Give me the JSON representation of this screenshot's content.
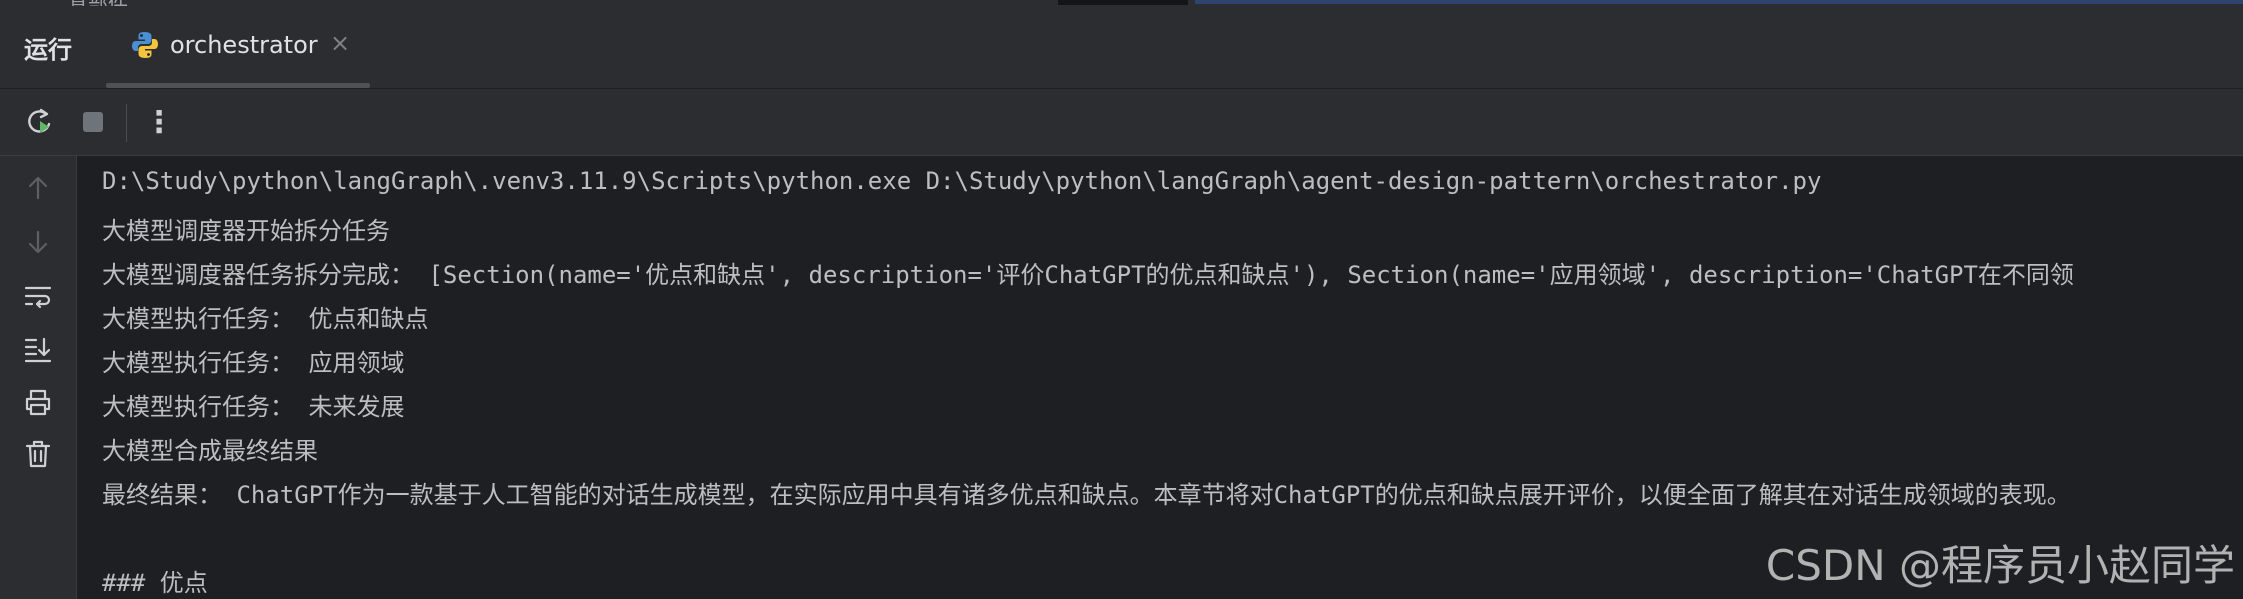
{
  "top_strip": {
    "glyph": "具部件"
  },
  "panel": {
    "title": "运行"
  },
  "tab": {
    "label": "orchestrator",
    "close": "×",
    "icon": "python-icon"
  },
  "toolbar": {
    "rerun_icon": "rerun-icon",
    "stop_icon": "stop-icon",
    "more": "⋮"
  },
  "gutter": {
    "icons": [
      "arrow-up-icon",
      "arrow-down-icon",
      "soft-wrap-icon",
      "scroll-to-end-icon",
      "print-icon",
      "trash-icon"
    ]
  },
  "console": {
    "lines": [
      "D:\\Study\\python\\langGraph\\.venv3.11.9\\Scripts\\python.exe D:\\Study\\python\\langGraph\\agent-design-pattern\\orchestrator.py",
      "大模型调度器开始拆分任务",
      "大模型调度器任务拆分完成： [Section(name='优点和缺点', description='评价ChatGPT的优点和缺点'), Section(name='应用领域', description='ChatGPT在不同领",
      "大模型执行任务： 优点和缺点",
      "大模型执行任务： 应用领域",
      "大模型执行任务： 未来发展",
      "大模型合成最终结果",
      "最终结果： ChatGPT作为一款基于人工智能的对话生成模型，在实际应用中具有诸多优点和缺点。本章节将对ChatGPT的优点和缺点展开评价，以便全面了解其在对话生成领域的表现。",
      "",
      "### 优点"
    ]
  },
  "watermark": "CSDN @程序员小赵同学",
  "colors": {
    "panel_bg": "#2b2d30",
    "console_bg": "#1e1f22",
    "text": "#bcbec4",
    "rerun_green": "#5fb865"
  }
}
